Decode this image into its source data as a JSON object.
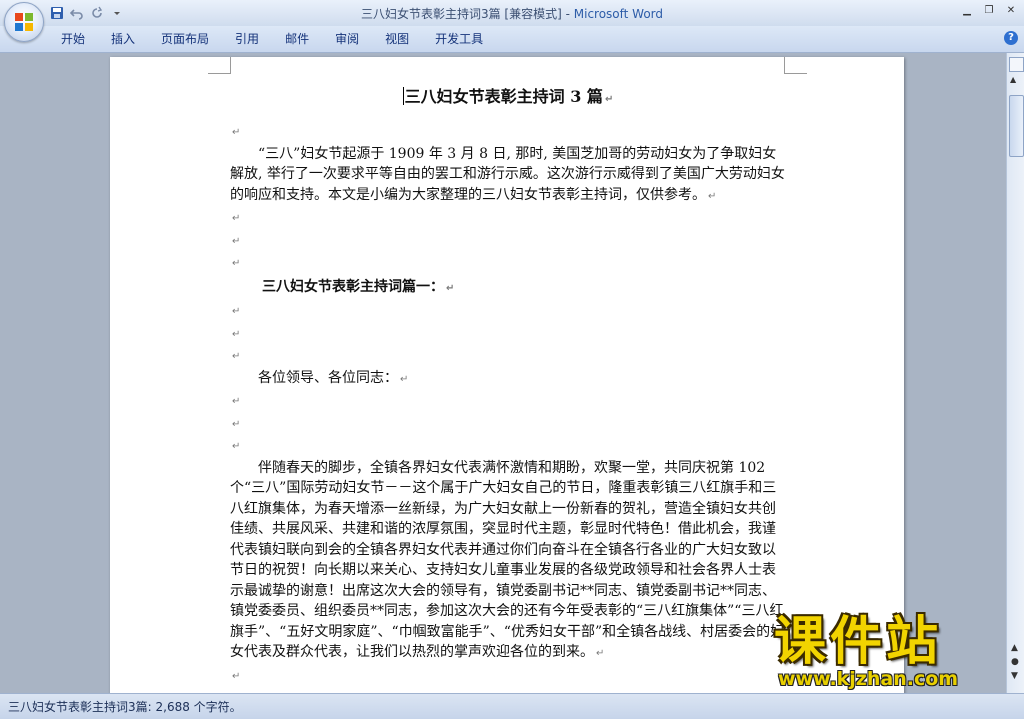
{
  "titlebar": {
    "doc_title": "三八妇女节表彰主持词3篇 [兼容模式]",
    "separator": " - ",
    "app_name": "Microsoft Word",
    "qat_icons": [
      "save-icon",
      "undo-icon",
      "redo-icon",
      "customize-qat-icon"
    ]
  },
  "window_controls": {
    "minimize": "▁",
    "restore": "❐",
    "close": "✕"
  },
  "ribbon": {
    "tabs": [
      "开始",
      "插入",
      "页面布局",
      "引用",
      "邮件",
      "审阅",
      "视图",
      "开发工具"
    ],
    "help": "?"
  },
  "document": {
    "title": "三八妇女节表彰主持词 3 篇",
    "intro": "“三八”妇女节起源于 1909 年 3 月 8 日, 那时, 美国芝加哥的劳动妇女为了争取妇女解放, 举行了一次要求平等自由的罢工和游行示威。这次游行示威得到了美国广大劳动妇女的响应和支持。本文是小编为大家整理的三八妇女节表彰主持词，仅供参考。",
    "heading1": "三八妇女节表彰主持词篇一：",
    "greeting": "各位领导、各位同志：",
    "body1": "伴随春天的脚步，全镇各界妇女代表满怀激情和期盼，欢聚一堂，共同庆祝第 102 个“三八”国际劳动妇女节－－这个属于广大妇女自己的节日，隆重表彰镇三八红旗手和三八红旗集体，为春天增添一丝新绿，为广大妇女献上一份新春的贺礼，营造全镇妇女共创佳绩、共展风采、共建和谐的浓厚氛围，突显时代主题，彰显时代特色！借此机会，我谨代表镇妇联向到会的全镇各界妇女代表并通过你们向奋斗在全镇各行各业的广大妇女致以节日的祝贺！向长期以来关心、支持妇女儿童事业发展的各级党政领导和社会各界人士表示最诚挚的谢意！出席这次大会的领导有，镇党委副书记**同志、镇党委副书记**同志、镇党委委员、组织委员**同志，参加这次大会的还有今年受表彰的“三八红旗集体”“三八红旗手”、“五好文明家庭”、“巾帼致富能手”、“优秀妇女干部”和全镇各战线、村居委会的妇女代表及群众代表，让我们以热烈的掌声欢迎各位的到来。",
    "para_mark": "↵"
  },
  "statusbar": {
    "text": "三八妇女节表彰主持词3篇: 2,688 个字符。"
  },
  "watermark": {
    "main": "课件站",
    "url": "www.kjzhan.com"
  },
  "colors": {
    "ribbon_text": "#15337a",
    "app_name": "#2d5ca8",
    "watermark_yellow": "#f2d400"
  }
}
